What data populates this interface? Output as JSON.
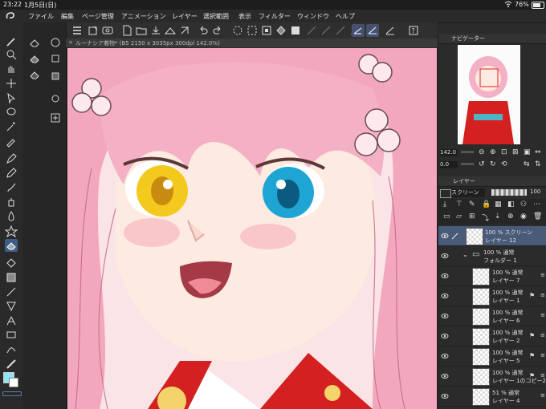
{
  "status": {
    "time": "23:22",
    "date": "1月5日(日)",
    "battery": "76%"
  },
  "menu": [
    "ファイル",
    "編集",
    "ページ管理",
    "アニメーション",
    "レイヤー",
    "選択範囲",
    "表示",
    "フィルター",
    "ウィンドウ",
    "ヘルプ"
  ],
  "tab": {
    "title": "ルーナシア着物* (B5 2150 x 3035px 300dpi 142.0%)"
  },
  "navigator": {
    "title": "ナビゲーター",
    "zoom": "142.0",
    "rotation": "0.0"
  },
  "layers_panel": {
    "title": "レイヤー",
    "blend_mode": "スクリーン",
    "opacity": "100",
    "layers": [
      {
        "line1": "100 % スクリーン",
        "line2": "レイヤー 12",
        "selected": true
      },
      {
        "line1": "100 % 通常",
        "line2": "フォルダー 1",
        "folder": true
      },
      {
        "line1": "100 % 通常",
        "line2": "レイヤー 7"
      },
      {
        "line1": "100 % 通常",
        "line2": "レイヤー 1"
      },
      {
        "line1": "100 % 通常",
        "line2": "レイヤー 6"
      },
      {
        "line1": "100 % 通常",
        "line2": "レイヤー 2"
      },
      {
        "line1": "100 % 通常",
        "line2": "レイヤー 5"
      },
      {
        "line1": "100 % 通常",
        "line2": "レイヤー 1のコピー2"
      },
      {
        "line1": "51 % 通常",
        "line2": "レイヤー 4"
      }
    ]
  },
  "colors": {
    "main": "#8fe6f2",
    "sub": "#ffffff",
    "accent": "#46506a"
  }
}
